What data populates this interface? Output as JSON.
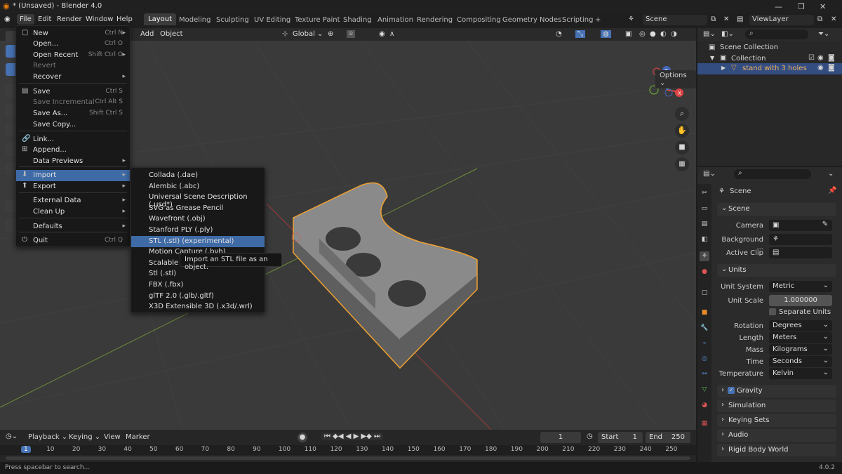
{
  "titlebar": {
    "title": "* (Unsaved) - Blender 4.0"
  },
  "menubar": {
    "menus": [
      "File",
      "Edit",
      "Render",
      "Window",
      "Help"
    ],
    "workspaces": [
      "Layout",
      "Modeling",
      "Sculpting",
      "UV Editing",
      "Texture Paint",
      "Shading",
      "Animation",
      "Rendering",
      "Compositing",
      "Geometry Nodes",
      "Scripting",
      "+"
    ],
    "scene_label": "Scene",
    "viewlayer_label": "ViewLayer"
  },
  "viewport_header": {
    "add": "Add",
    "object": "Object",
    "orientation": "Global",
    "options": "Options"
  },
  "file_menu": [
    {
      "label": "New",
      "key": "Ctrl N",
      "arrow": "▸"
    },
    {
      "label": "Open...",
      "key": "Ctrl O"
    },
    {
      "label": "Open Recent",
      "key": "Shift Ctrl O",
      "arrow": "▸"
    },
    {
      "label": "Revert",
      "disabled": true
    },
    {
      "label": "Recover",
      "arrow": "▸"
    },
    {
      "label": "Save",
      "key": "Ctrl S"
    },
    {
      "label": "Save Incremental",
      "key": "Ctrl Alt S",
      "disabled": true
    },
    {
      "label": "Save As...",
      "key": "Shift Ctrl S"
    },
    {
      "label": "Save Copy..."
    },
    {
      "label": "Link..."
    },
    {
      "label": "Append..."
    },
    {
      "label": "Data Previews",
      "arrow": "▸"
    },
    {
      "label": "Import",
      "arrow": "▸",
      "highlight": true
    },
    {
      "label": "Export",
      "arrow": "▸"
    },
    {
      "label": "External Data",
      "arrow": "▸"
    },
    {
      "label": "Clean Up",
      "arrow": "▸"
    },
    {
      "label": "Defaults",
      "arrow": "▸"
    },
    {
      "label": "Quit",
      "key": "Ctrl Q"
    }
  ],
  "import_menu": [
    "Collada (.dae)",
    "Alembic (.abc)",
    "Universal Scene Description (.usd*)",
    "SVG as Grease Pencil",
    "Wavefront (.obj)",
    "Stanford PLY (.ply)",
    "STL (.stl) (experimental)",
    "Motion Capture (.bvh)",
    "Scalable Vector Graphics (.svg)",
    "Stl (.stl)",
    "FBX (.fbx)",
    "glTF 2.0 (.glb/.gltf)",
    "X3D Extensible 3D (.x3d/.wrl)"
  ],
  "tooltip": "Import an STL file as an object.",
  "outliner": {
    "scene_collection": "Scene Collection",
    "collection": "Collection",
    "object": "stand with 3 holes"
  },
  "properties": {
    "scene_title": "Scene",
    "scene_section": "Scene",
    "camera_label": "Camera",
    "background_label": "Background ...",
    "active_clip_label": "Active Clip",
    "units_section": "Units",
    "unit_system_label": "Unit System",
    "unit_system": "Metric",
    "unit_scale_label": "Unit Scale",
    "unit_scale": "1.000000",
    "separate_units": "Separate Units",
    "rotation_label": "Rotation",
    "rotation": "Degrees",
    "length_label": "Length",
    "length": "Meters",
    "mass_label": "Mass",
    "mass": "Kilograms",
    "time_label": "Time",
    "time": "Seconds",
    "temperature_label": "Temperature",
    "temperature": "Kelvin",
    "gravity": "Gravity",
    "simulation": "Simulation",
    "keying_sets": "Keying Sets",
    "audio": "Audio",
    "rigid_body_world": "Rigid Body World"
  },
  "timeline": {
    "playback": "Playback",
    "keying": "Keying",
    "view": "View",
    "marker": "Marker",
    "current_frame": "1",
    "start_label": "Start",
    "start": "1",
    "end_label": "End",
    "end": "250",
    "ticks": [
      "1",
      "10",
      "20",
      "30",
      "40",
      "50",
      "60",
      "70",
      "80",
      "90",
      "100",
      "110",
      "120",
      "130",
      "140",
      "150",
      "160",
      "170",
      "180",
      "190",
      "200",
      "210",
      "220",
      "230",
      "240",
      "250"
    ]
  },
  "statusbar": {
    "hint": "Press spacebar to search...",
    "version": "4.0.2"
  }
}
